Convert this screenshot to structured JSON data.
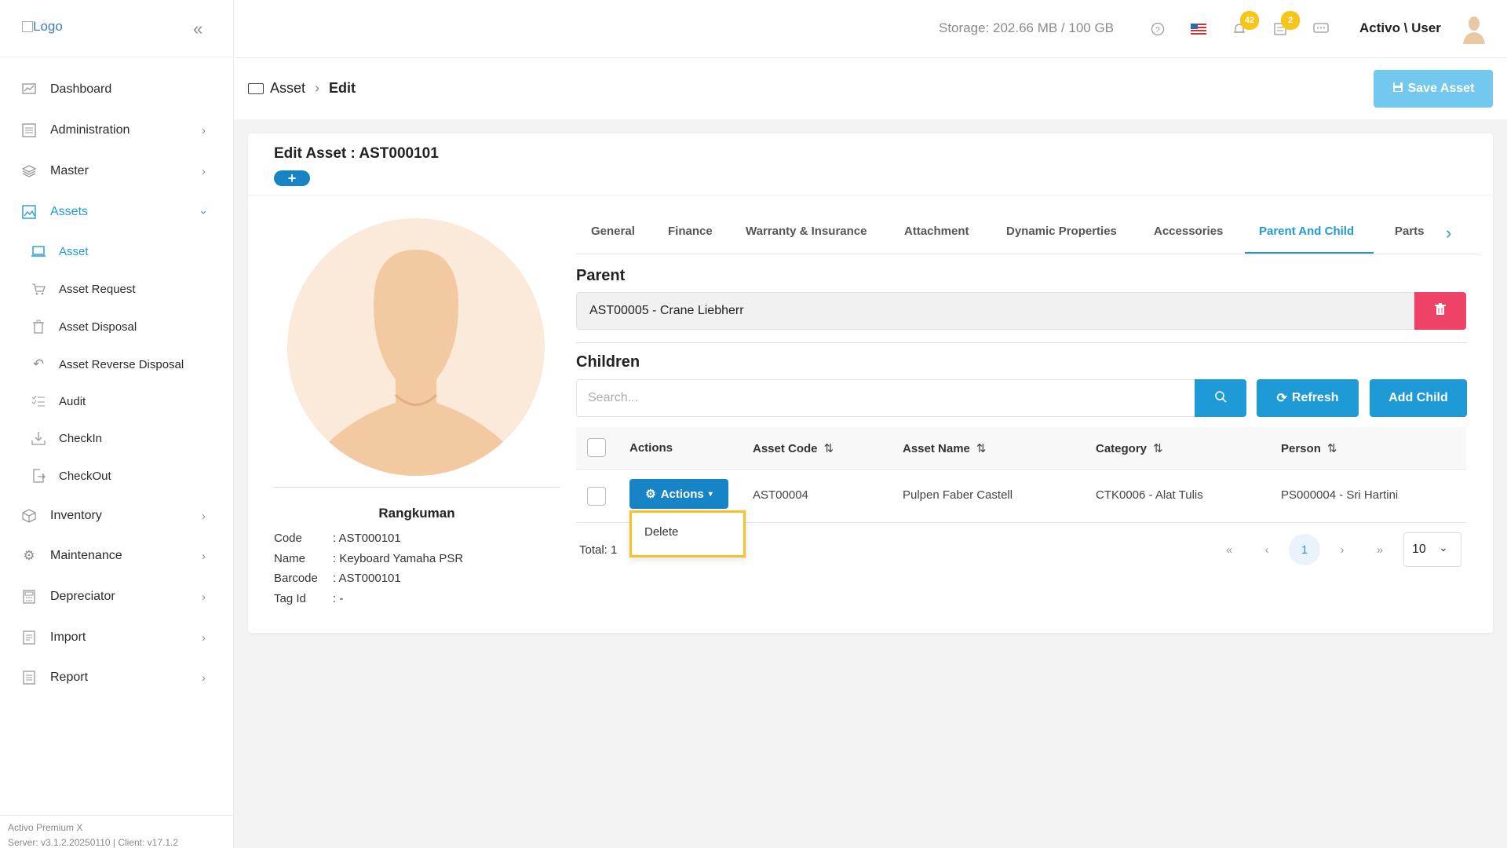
{
  "sidebar": {
    "logo_alt": "Logo",
    "items": [
      {
        "label": "Dashboard",
        "icon": "chart-icon"
      },
      {
        "label": "Administration",
        "icon": "list-icon"
      },
      {
        "label": "Master",
        "icon": "layers-icon"
      },
      {
        "label": "Assets",
        "icon": "image-icon",
        "active": true
      },
      {
        "label": "Asset",
        "sub": true,
        "active": true
      },
      {
        "label": "Asset Request",
        "sub": true
      },
      {
        "label": "Asset Disposal",
        "sub": true
      },
      {
        "label": "Asset Reverse Disposal",
        "sub": true
      },
      {
        "label": "Audit",
        "sub": true
      },
      {
        "label": "CheckIn",
        "sub": true
      },
      {
        "label": "CheckOut",
        "sub": true
      },
      {
        "label": "Inventory"
      },
      {
        "label": "Maintenance"
      },
      {
        "label": "Depreciator"
      },
      {
        "label": "Import"
      },
      {
        "label": "Report"
      }
    ],
    "footer_line1": "Activo Premium X",
    "footer_line2": "Server: v3.1.2.20250110 | Client: v17.1.2"
  },
  "topbar": {
    "storage": "Storage: 202.66 MB / 100 GB",
    "notif_count_1": "42",
    "notif_count_2": "2",
    "username": "Activo \\ User"
  },
  "breadcrumb": {
    "root": "Asset",
    "current": "Edit"
  },
  "save_button": "Save Asset",
  "card": {
    "title": "Edit Asset : AST000101",
    "plus": "+"
  },
  "summary": {
    "title": "Rangkuman",
    "rows": [
      {
        "key": "Code",
        "value": ": AST000101"
      },
      {
        "key": "Name",
        "value": ": Keyboard Yamaha PSR"
      },
      {
        "key": "Barcode",
        "value": ": AST000101"
      },
      {
        "key": "Tag Id",
        "value": ": -"
      }
    ]
  },
  "tabs": [
    "General",
    "Finance",
    "Warranty & Insurance",
    "Attachment",
    "Dynamic Properties",
    "Accessories",
    "Parent And Child",
    "Parts"
  ],
  "active_tab": "Parent And Child",
  "parent": {
    "title": "Parent",
    "value": "AST00005 - Crane Liebherr"
  },
  "children": {
    "title": "Children",
    "search_placeholder": "Search...",
    "refresh_label": "Refresh",
    "add_child_label": "Add Child",
    "columns": [
      "Actions",
      "Asset Code",
      "Asset Name",
      "Category",
      "Person"
    ],
    "rows": [
      {
        "actions_label": "Actions",
        "asset_code": "AST00004",
        "asset_name": "Pulpen Faber Castell",
        "category": "CTK0006 - Alat Tulis",
        "person": "PS000004 - Sri Hartini"
      }
    ],
    "dropdown_item": "Delete",
    "total": "Total: 1",
    "current_page": "1",
    "page_size": "10"
  },
  "colors": {
    "accent": "#1e9bd7",
    "save_button": "#72c8ee",
    "delete_button": "#ee4266",
    "badge": "#f5c518",
    "highlight": "#f5c12a"
  }
}
